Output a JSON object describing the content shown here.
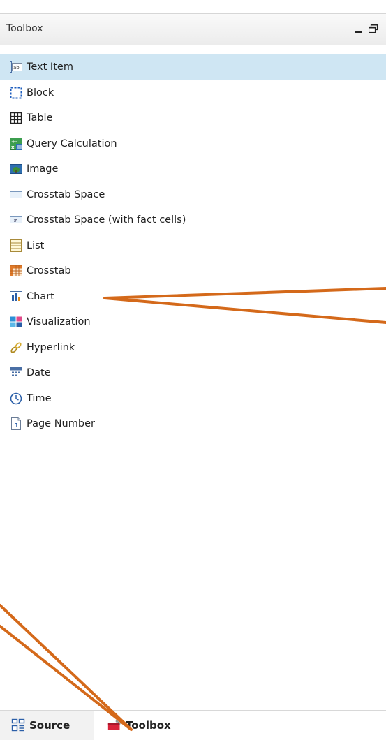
{
  "panel": {
    "title": "Toolbox"
  },
  "items": [
    {
      "label": "Text Item",
      "icon": "text-item-icon"
    },
    {
      "label": "Block",
      "icon": "block-icon"
    },
    {
      "label": "Table",
      "icon": "table-icon"
    },
    {
      "label": "Query Calculation",
      "icon": "query-calculation-icon"
    },
    {
      "label": "Image",
      "icon": "image-icon"
    },
    {
      "label": "Crosstab Space",
      "icon": "crosstab-space-icon"
    },
    {
      "label": "Crosstab Space (with fact cells)",
      "icon": "crosstab-space-fact-icon"
    },
    {
      "label": "List",
      "icon": "list-icon"
    },
    {
      "label": "Crosstab",
      "icon": "crosstab-icon"
    },
    {
      "label": "Chart",
      "icon": "chart-icon"
    },
    {
      "label": "Visualization",
      "icon": "visualization-icon"
    },
    {
      "label": "Hyperlink",
      "icon": "hyperlink-icon"
    },
    {
      "label": "Date",
      "icon": "date-icon"
    },
    {
      "label": "Time",
      "icon": "time-icon"
    },
    {
      "label": "Page Number",
      "icon": "page-number-icon"
    }
  ],
  "selected_item": "Text Item",
  "tabs": [
    {
      "label": "Source",
      "icon": "source-icon"
    },
    {
      "label": "Toolbox",
      "icon": "toolbox-icon",
      "active": true
    }
  ],
  "colors": {
    "selection": "#cfe6f3",
    "annotation": "#d4691a"
  }
}
